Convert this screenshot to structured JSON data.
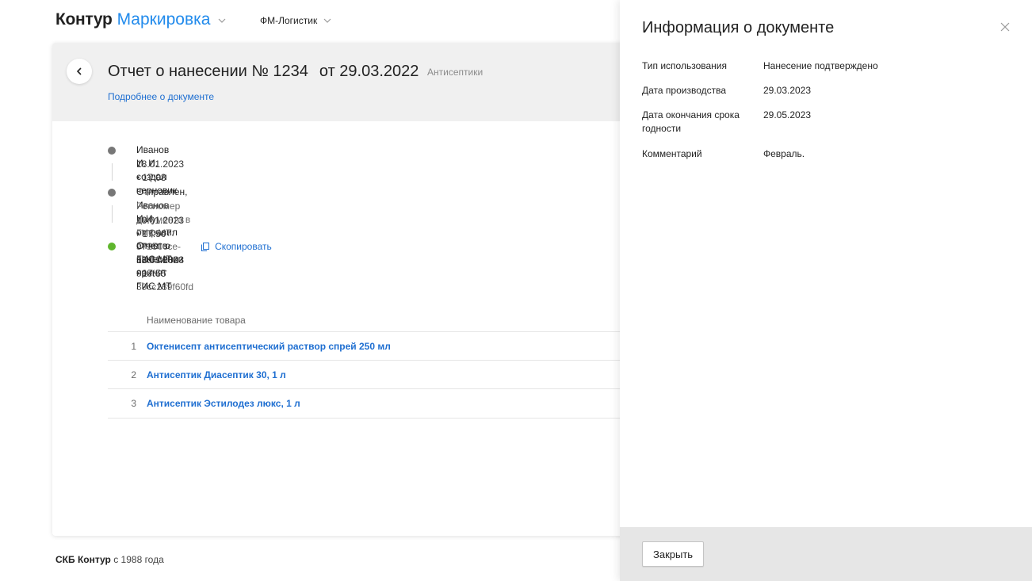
{
  "header": {
    "brand": "Контур",
    "product": "Маркировка",
    "organization": "ФМ-Логистик",
    "icons": {
      "product_menu": "chevron-down-icon",
      "org_menu": "chevron-down-icon"
    }
  },
  "document": {
    "title": "Отчет о нанесении № 1234",
    "date": "от 29.03.2022",
    "category": "Антисептики",
    "details_link": "Подробнее о документе",
    "back_icon": "chevron-left-icon"
  },
  "timeline": [
    {
      "text": "Иванов И. И. создал черновик",
      "time": "18.01.2023 • 17:08",
      "status": "done"
    },
    {
      "text": "Отправлен, Иванов И.И. отправил отчет в ГИС МТ",
      "reg_label": "Рег.номер документа в ГИС МТ: 57250cce-52cf-408b-99ef-39cc239f60fd",
      "copy_label": "Скопировать",
      "time": "18.01.2023 • 17:50",
      "status": "done"
    },
    {
      "text": "Отчет о нанесении принят ГИС МТ",
      "time": "18.01.2023 • 17:55",
      "status": "success"
    }
  ],
  "goods": {
    "column_header": "Наименование товара",
    "rows": [
      {
        "num": "1",
        "name": "Октенисепт антисептический раствор спрей 250 мл"
      },
      {
        "num": "2",
        "name": "Антисептик Диасептик 30, 1 л"
      },
      {
        "num": "3",
        "name": "Антисептик Эстилодез люкс, 1 л"
      }
    ]
  },
  "footer": {
    "company": "СКБ Контур",
    "since": " с 1988 года"
  },
  "panel": {
    "title": "Информация о документе",
    "close_icon": "close-icon",
    "fields": [
      {
        "label": "Тип использования",
        "value": "Нанесение подтверждено"
      },
      {
        "label": "Дата производства",
        "value": "29.03.2023"
      },
      {
        "label": "Дата окончания срока годности",
        "value": "29.05.2023"
      },
      {
        "label": "Комментарий",
        "value": "Февраль."
      }
    ],
    "close_button": "Закрыть"
  },
  "colors": {
    "accent": "#228bec",
    "link": "#1f6fd1",
    "success": "#5fb62d",
    "neutral_dot": "#777777",
    "header_bg": "#f0f0f0",
    "panel_footer_bg": "#e6e6e6"
  }
}
